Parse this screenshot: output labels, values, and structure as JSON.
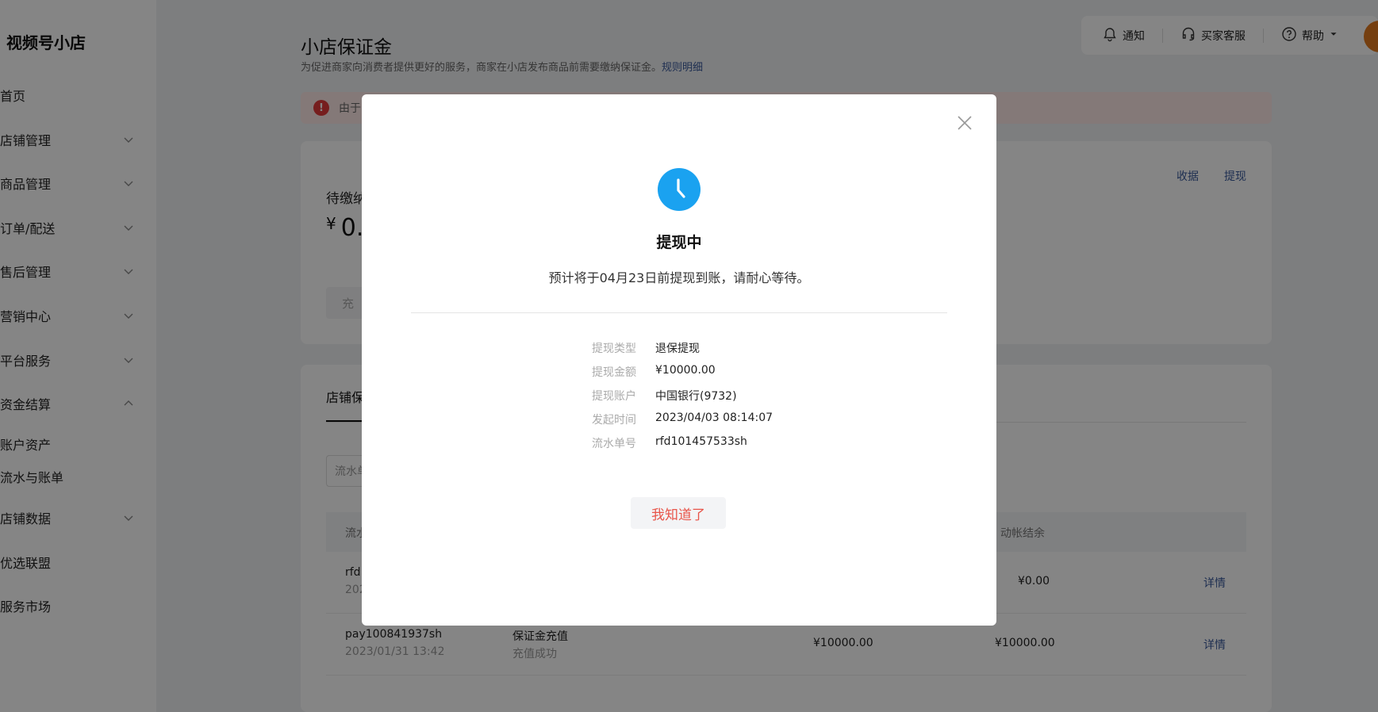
{
  "app": {
    "logo": "视频号小店"
  },
  "sidebar": {
    "items": [
      {
        "label": "首页",
        "chevron": "none"
      },
      {
        "label": "店铺管理",
        "chevron": "down"
      },
      {
        "label": "商品管理",
        "chevron": "down"
      },
      {
        "label": "订单/配送",
        "chevron": "down"
      },
      {
        "label": "售后管理",
        "chevron": "down"
      },
      {
        "label": "营销中心",
        "chevron": "down"
      },
      {
        "label": "平台服务",
        "chevron": "down"
      },
      {
        "label": "资金结算",
        "chevron": "up"
      },
      {
        "label": "店铺数据",
        "chevron": "down"
      },
      {
        "label": "优选联盟",
        "chevron": "none"
      },
      {
        "label": "服务市场",
        "chevron": "none"
      }
    ],
    "subitems": [
      "账户资产",
      "流水与账单"
    ]
  },
  "topbar": {
    "notify": "通知",
    "service": "买家客服",
    "help": "帮助"
  },
  "page": {
    "title": "小店保证金",
    "desc": "为促进商家向消费者提供更好的服务，商家在小店发布商品前需要缴纳保证金。",
    "rules_link": "规则明细"
  },
  "alert": {
    "text": "由于"
  },
  "deposit_card": {
    "label": "待缴纳",
    "yen": "¥",
    "amount": "0.",
    "collect": "收据",
    "withdraw": "提现",
    "recharge_button": "充"
  },
  "records": {
    "tab": "店铺保",
    "search_placeholder": "流水单",
    "headers": {
      "col1": "流水",
      "col_balance": "动帐结余"
    },
    "rows": [
      {
        "id": "rfd",
        "time": "202",
        "type": "",
        "status": "",
        "amount": "",
        "balance": "¥0.00",
        "detail": "详情"
      },
      {
        "id": "pay100841937sh",
        "time": "2023/01/31 13:42",
        "type": "保证金充值",
        "status": "充值成功",
        "amount": "¥10000.00",
        "balance": "¥10000.00",
        "detail": "详情"
      }
    ]
  },
  "modal": {
    "title": "提现中",
    "desc": "预计将于04月23日前提现到账，请耐心等待。",
    "fields": [
      {
        "key": "提现类型",
        "value": "退保提现"
      },
      {
        "key": "提现金额",
        "value": "¥10000.00"
      },
      {
        "key": "提现账户",
        "value": "中国银行(9732)"
      },
      {
        "key": "发起时间",
        "value": "2023/04/03 08:14:07"
      },
      {
        "key": "流水单号",
        "value": "rfd101457533sh"
      }
    ],
    "ok_button": "我知道了"
  },
  "colors": {
    "status_icon": "#1aa2f0",
    "ok_text": "#e8554a",
    "link": "#3a5a9c",
    "alert_bg": "#fde8e6"
  }
}
